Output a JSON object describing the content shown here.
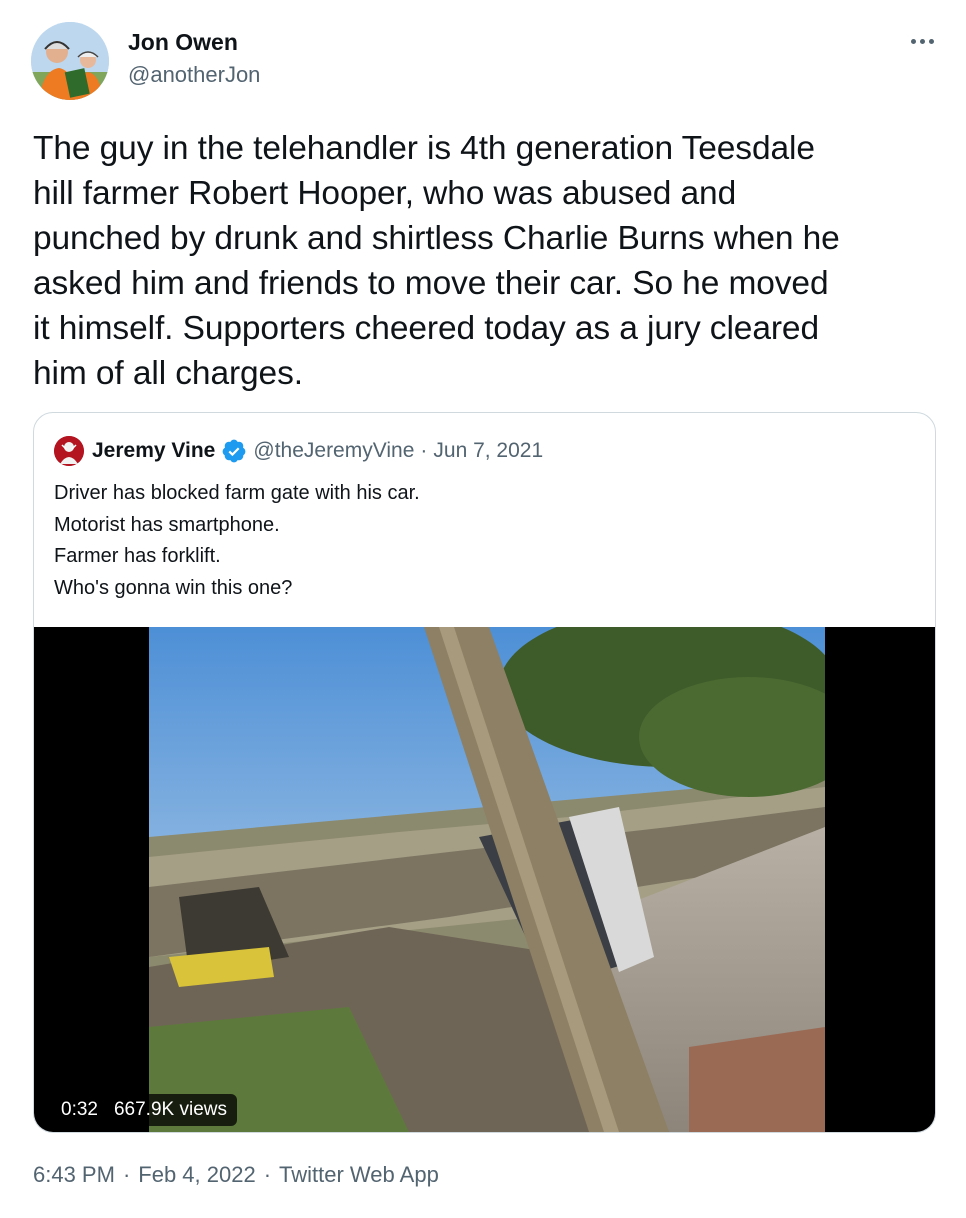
{
  "author": {
    "name": "Jon Owen",
    "handle": "@anotherJon",
    "avatar_icon": "profile-avatar-icon"
  },
  "more_icon": "more-horizontal-icon",
  "tweet": {
    "lines": [
      "The guy in the telehandler is 4th generation Teesdale",
      "hill farmer Robert Hooper, who was abused and",
      "punched by drunk and shirtless Charlie Burns when he",
      "asked him and friends to move their car. So he moved",
      "it himself. Supporters cheered today as a jury cleared",
      "him of all charges."
    ]
  },
  "quoted": {
    "name": "Jeremy Vine",
    "verified_icon": "verified-badge-icon",
    "handle": "@theJeremyVine",
    "separator": "·",
    "date": "Jun 7, 2021",
    "lines": [
      "Driver has blocked farm gate with his car.",
      "Motorist has smartphone.",
      "Farmer has forklift.",
      "Who's gonna win this one?"
    ],
    "video": {
      "duration": "0:32",
      "views": "667.9K views"
    }
  },
  "meta": {
    "time": "6:43 PM",
    "separator": "·",
    "date": "Feb 4, 2022",
    "source": "Twitter Web App"
  },
  "colors": {
    "text": "#0f1419",
    "secondary": "#536471",
    "border": "#cfd9de",
    "verified": "#1d9bf0"
  }
}
